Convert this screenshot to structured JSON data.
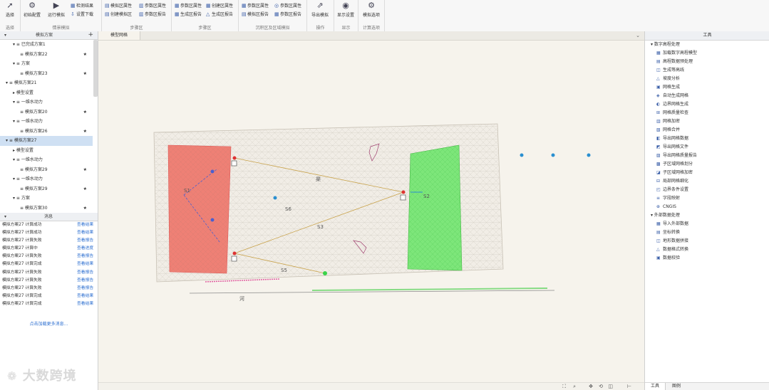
{
  "ribbon": {
    "groups": [
      {
        "label": "选择",
        "buttons": [
          {
            "label": "选择"
          }
        ]
      },
      {
        "label": "情景模拟",
        "buttons": [
          {
            "label": "初始配置"
          },
          {
            "label": "运行模拟"
          }
        ],
        "small": [
          {
            "label": "检测结果"
          },
          {
            "label": "设置下载"
          }
        ]
      },
      {
        "label": "步骤区",
        "small": [
          {
            "label": "模拟区属性"
          },
          {
            "label": "创建模拟区"
          },
          {
            "label": "参数区属性"
          },
          {
            "label": "参数区报告"
          }
        ]
      },
      {
        "label": "步骤区",
        "small": [
          {
            "label": "参数区属性"
          },
          {
            "label": "生成区报告"
          },
          {
            "label": "创建区属性"
          },
          {
            "label": "生成区报告"
          }
        ]
      },
      {
        "label": "沉积区及区域模拟",
        "small": [
          {
            "label": "参数区属性"
          },
          {
            "label": "模拟区报告"
          },
          {
            "label": "参数区属性"
          },
          {
            "label": "参数区报告"
          }
        ]
      },
      {
        "label": "操作",
        "buttons": [
          {
            "label": "导出模拟"
          }
        ]
      },
      {
        "label": "显示",
        "buttons": [
          {
            "label": "显示设置"
          }
        ]
      },
      {
        "label": "计算选项",
        "buttons": [
          {
            "label": "模拟选项"
          }
        ]
      }
    ]
  },
  "left_panel": {
    "title": "模拟方案",
    "tree": [
      {
        "label": "▾ ≡ 已完成方案1",
        "indent": 1,
        "star": false
      },
      {
        "label": "≡ 模拟方案22",
        "indent": 2,
        "star": true
      },
      {
        "label": "▾ ≡ 方案",
        "indent": 1,
        "star": false
      },
      {
        "label": "≡ 模拟方案23",
        "indent": 2,
        "star": true
      },
      {
        "label": "▾ ≡ 模拟方案21",
        "indent": 0,
        "star": false
      },
      {
        "label": "▸ 模型设置",
        "indent": 1,
        "star": false
      },
      {
        "label": "▾ ≡ 一维水动力",
        "indent": 1,
        "star": false
      },
      {
        "label": "≡ 模拟方案20",
        "indent": 2,
        "star": true
      },
      {
        "label": "▾ ≡ 一维水动力",
        "indent": 1,
        "star": false
      },
      {
        "label": "≡ 模拟方案26",
        "indent": 2,
        "star": true
      },
      {
        "label": "▾ ≡ 模拟方案27",
        "indent": 0,
        "star": false,
        "selected": true
      },
      {
        "label": "▸ 模型设置",
        "indent": 1,
        "star": false
      },
      {
        "label": "▾ ≡ 一维水动力",
        "indent": 1,
        "star": false
      },
      {
        "label": "≡ 模拟方案29",
        "indent": 2,
        "star": true
      },
      {
        "label": "▾ ≡ 一维水动力",
        "indent": 1,
        "star": false
      },
      {
        "label": "≡ 模拟方案29",
        "indent": 2,
        "star": true
      },
      {
        "label": "▾ ≡ 方案",
        "indent": 1,
        "star": false
      },
      {
        "label": "≡ 模拟方案30",
        "indent": 2,
        "star": true
      }
    ],
    "messages_title": "消息",
    "messages": [
      {
        "text": "模拟方案27 计算成功",
        "action": "查看结果"
      },
      {
        "text": "模拟方案27 计算成功",
        "action": "查看结果"
      },
      {
        "text": "模拟方案27 计算失败",
        "action": "查看报告"
      },
      {
        "text": "模拟方案27 计算中",
        "action": "查看进度"
      },
      {
        "text": "模拟方案27 计算失败",
        "action": "查看报告"
      },
      {
        "text": "模拟方案27 计算完成",
        "action": "查看结果"
      },
      {
        "text": "模拟方案27 计算失败",
        "action": "查看报告"
      },
      {
        "text": "模拟方案27 计算失败",
        "action": "查看报告"
      },
      {
        "text": "模拟方案27 计算失败",
        "action": "查看报告"
      },
      {
        "text": "模拟方案27 计算完成",
        "action": "查看结果"
      },
      {
        "text": "模拟方案27 计算完成",
        "action": "查看结果"
      }
    ],
    "more_link": "点击加载更多消息...",
    "logo_text": "大数跨境"
  },
  "tab": {
    "label": "模型网格"
  },
  "map_labels": {
    "s1": "S1",
    "s2": "S2",
    "s3": "S3",
    "s4": "S4",
    "s5": "S5",
    "s6": "S6",
    "river": "河",
    "channel": "渠"
  },
  "right_panel": {
    "title": "工具",
    "sections": [
      {
        "label": "▾ 数字高程处理",
        "items": [
          "加载数字高程模型",
          "高程数据预处理",
          "生成等高线",
          "坡度分析",
          "网格生成",
          "自动生成网格",
          "边界网格生成",
          "网格质量检查",
          "网格加密",
          "网格合并",
          "导出网格数据",
          "导出网格文件",
          "导出网格质量报告",
          "子区域网格划分",
          "子区域网格加密",
          "局部网格细化",
          "边界条件设置",
          "字段映射",
          "CNGIS"
        ]
      },
      {
        "label": "▾ 外部数据处理",
        "items": [
          "导入外部数据",
          "坐标转换",
          "地形数据拼接",
          "数据格式转换",
          "数据校验"
        ]
      }
    ],
    "bottom_tabs": [
      "工具",
      "图例"
    ]
  }
}
